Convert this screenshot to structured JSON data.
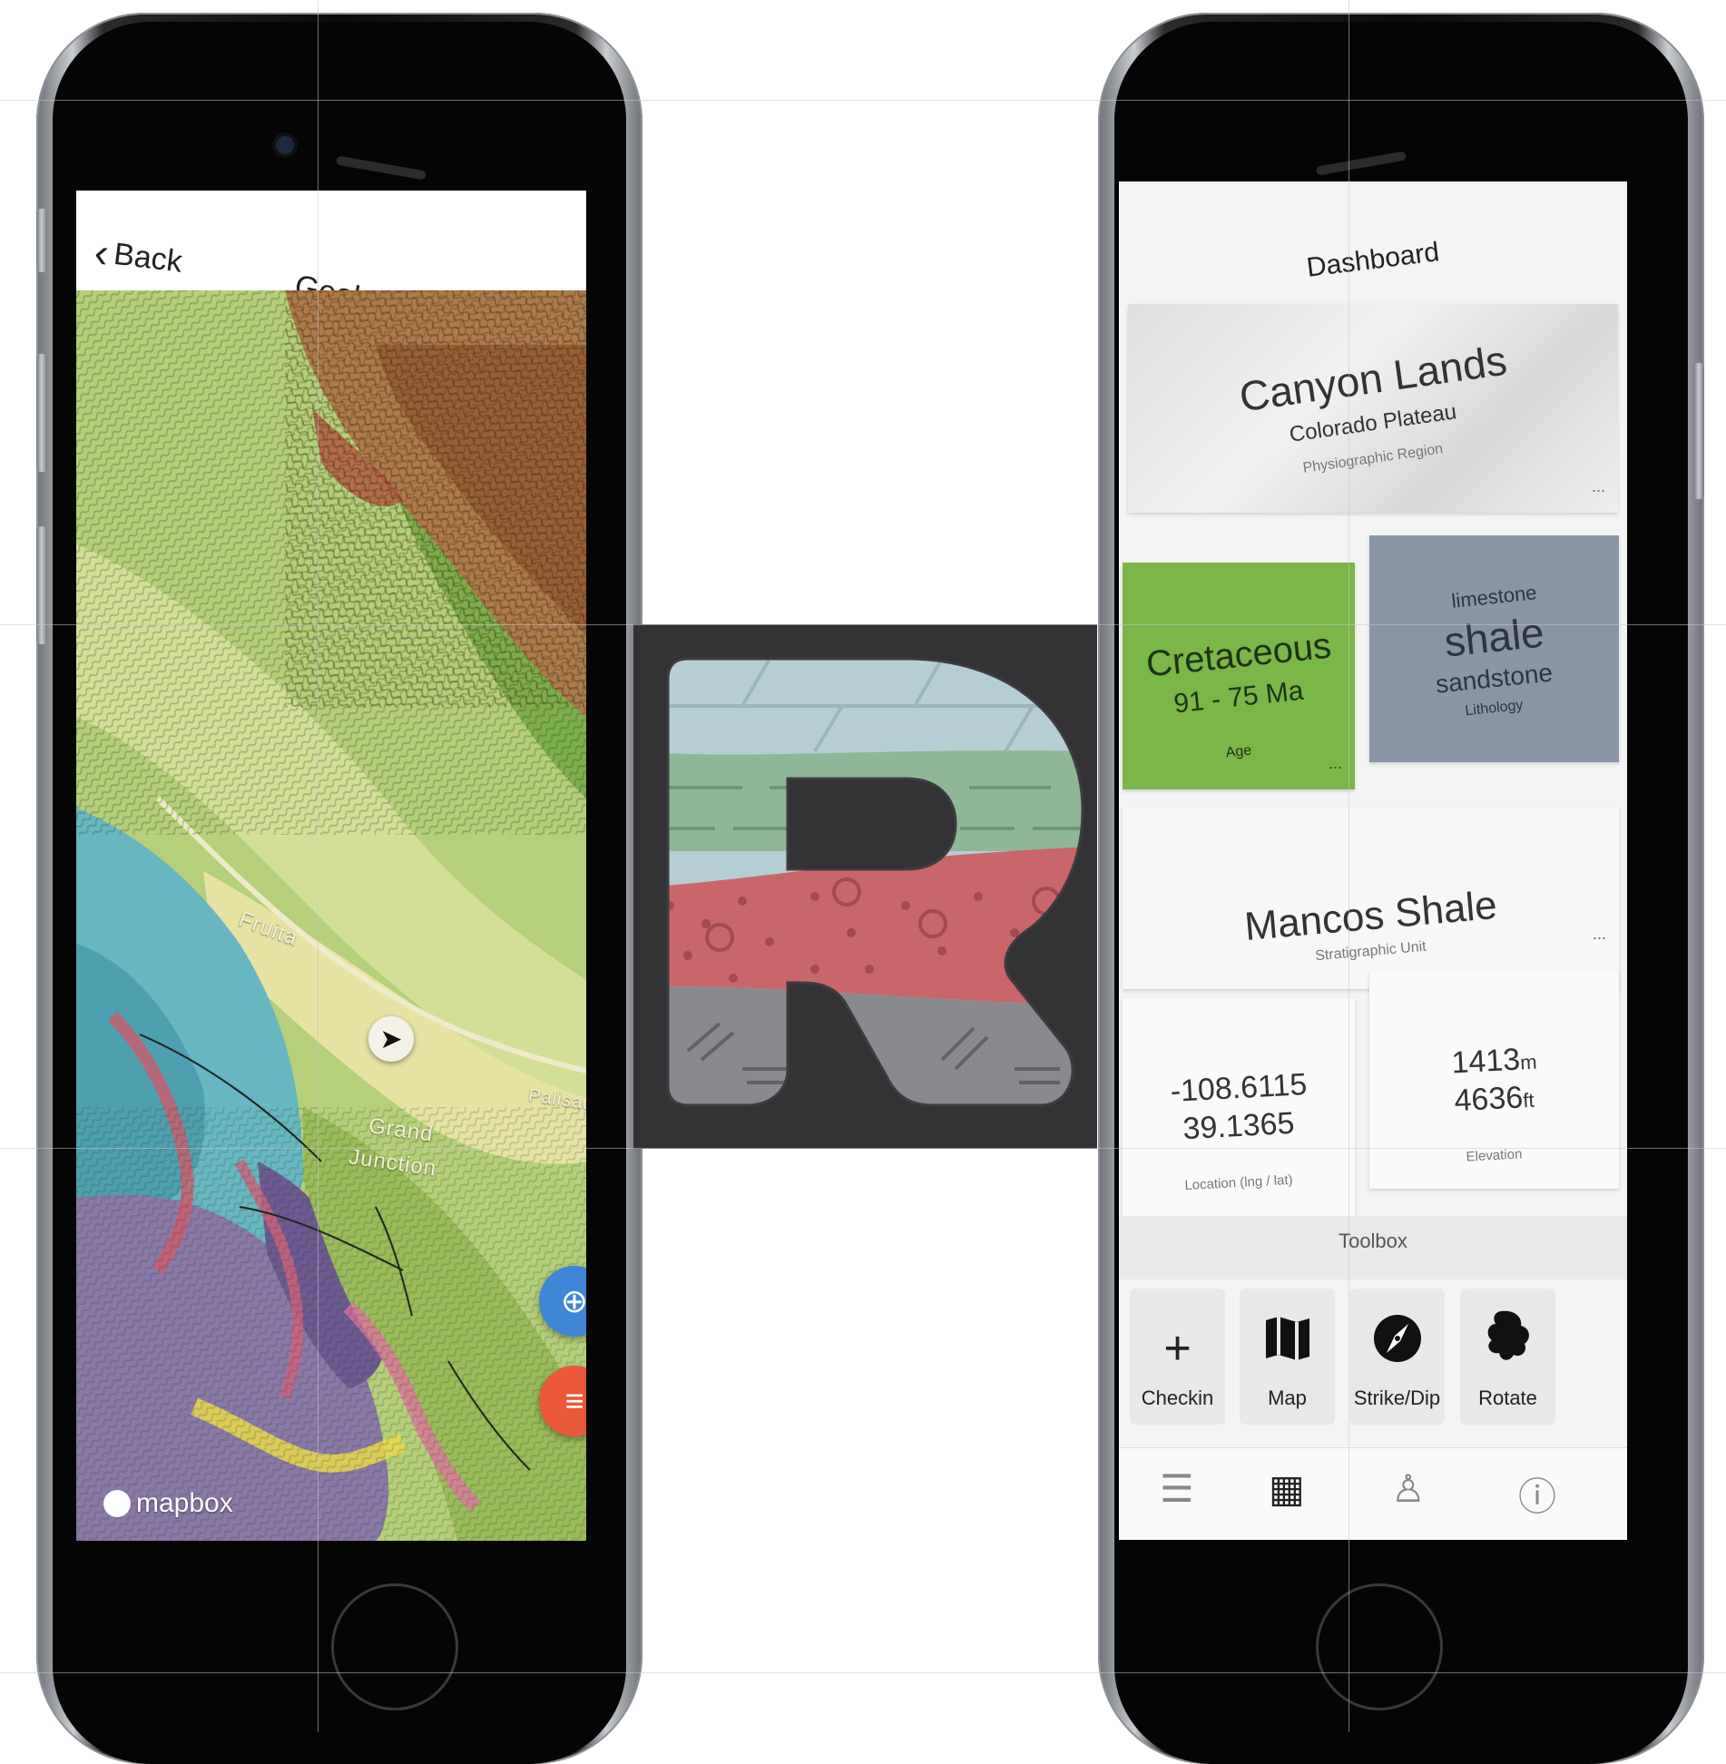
{
  "left_phone": {
    "nav": {
      "back_label": "Back",
      "title": "Geologic Map"
    },
    "map": {
      "labels": [
        "Fruita",
        "Grand",
        "Junction",
        "Palisade"
      ],
      "fab_add_icon": "plus-circle-icon",
      "fab_menu_icon": "menu-icon",
      "attribution": "mapbox"
    }
  },
  "logo": {
    "icon": "rocklab-r-logo"
  },
  "right_phone": {
    "title": "Dashboard",
    "region_card": {
      "name": "Canyon Lands",
      "sub": "Colorado Plateau",
      "caption": "Physiographic Region",
      "more": "..."
    },
    "age_card": {
      "name": "Cretaceous",
      "range": "91 - 75 Ma",
      "caption": "Age",
      "more": "..."
    },
    "lithology_card": {
      "top": "limestone",
      "main": "shale",
      "bottom": "sandstone",
      "caption": "Lithology"
    },
    "unit_card": {
      "name": "Mancos Shale",
      "caption": "Stratigraphic Unit",
      "more": "..."
    },
    "location_card": {
      "lng": "-108.6115",
      "lat": "39.1365",
      "caption": "Location (lng / lat)"
    },
    "elevation_card": {
      "meters": "1413",
      "meters_unit": "m",
      "feet": "4636",
      "feet_unit": "ft",
      "caption": "Elevation"
    },
    "toolbox": {
      "title": "Toolbox",
      "tools": [
        {
          "label": "Checkin",
          "icon": "plus-icon"
        },
        {
          "label": "Map",
          "icon": "map-icon"
        },
        {
          "label": "Strike/Dip",
          "icon": "compass-icon"
        },
        {
          "label": "Rotate",
          "icon": "rotate-rock-icon"
        }
      ]
    },
    "tabbar": [
      "list-icon",
      "grid-icon",
      "profile-icon",
      "help-icon"
    ]
  },
  "colors": {
    "fab_blue": "#3f86d6",
    "fab_orange": "#e9593a",
    "age_green": "#7ab648",
    "lithology_gray": "#8a95a6",
    "logo_bg": "#333234"
  }
}
